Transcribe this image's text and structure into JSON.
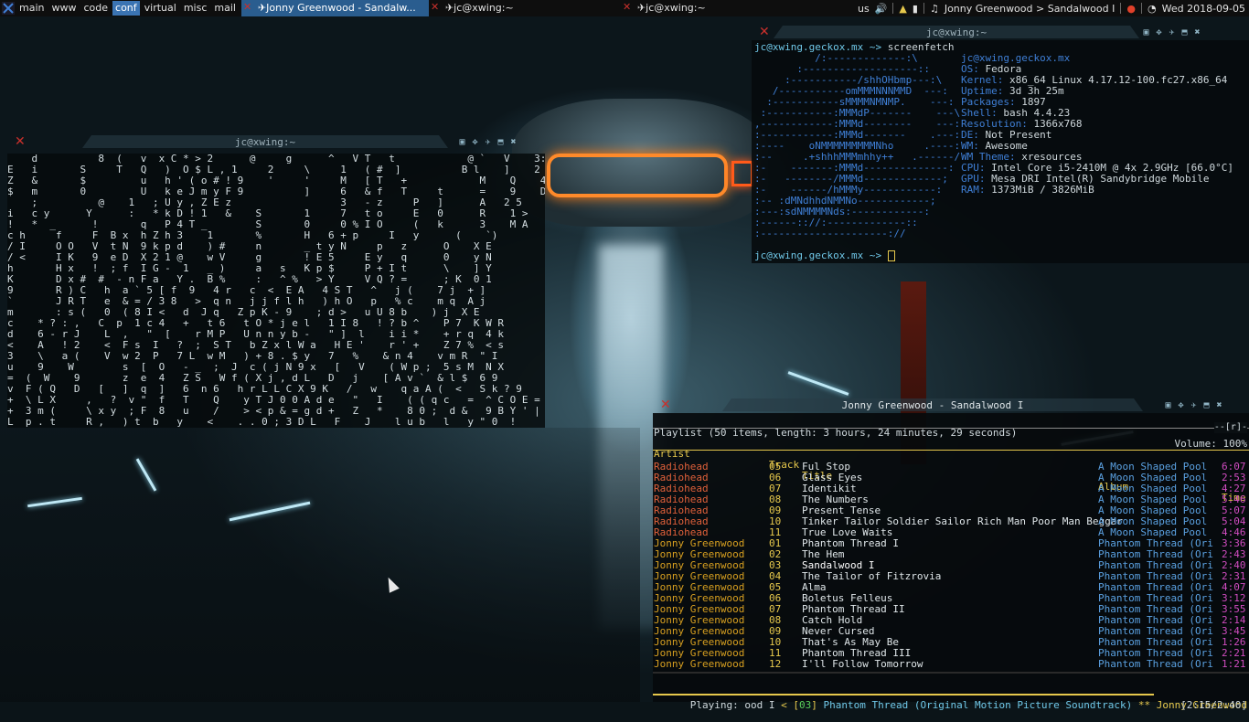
{
  "topbar": {
    "tags": [
      "main",
      "www",
      "code",
      "conf",
      "virtual",
      "misc",
      "mail"
    ],
    "active_tag": "conf",
    "tasks": [
      {
        "title": "Jonny Greenwood - Sandalw...",
        "active": true
      },
      {
        "title": "jc@xwing:~",
        "active": false
      },
      {
        "title": "jc@xwing:~",
        "active": false
      }
    ],
    "layout": "us",
    "now_playing": "Jonny Greenwood > Sandalwood I",
    "date": "Wed 2018-09-05"
  },
  "matrix_window": {
    "title": "jc@xwing:~",
    "lines": [
      "    d          8  (   v  x C * > 2      @     g      ^   V T   t            @ `   V    3:",
      "E   i       S     T   Q   )  O $ L , 1     2     \\     1   ( #  ]          B l    ]    2 p",
      "Z   &       $         u   h ' ( o # ! 9    '     '     M   [ T   +            M    Q    4",
      "$   m       0         U   k e J m y F 9          ]     6   & f   T     t      =    9    D",
      "    ;          @    1   ; U y , Z E z                  3   - z     P   ]      A   2 5    S",
      "i   c y      Y      :   * k D ! 1   &    S       1     7   t o     E   0      R    1 >   6",
      "!   *  _      !       q   P 4 T _        S       0     0 % I O     (   k      3    M A",
      "c h     f     F  B x  h Z h 3    1       %       H   6 + p     I   y      (    `)",
      "/ I     O O   V  t N  9 k p d    ) #     n       _ t y N     p   z      O    X E",
      "/ <     I K   9  e D  X 2 1 @    w V     g       ! E 5     E y   q      0    y N",
      "h       H x   !  ; f  I G -  1   _ )     a   s   K p $     P + I t      \\    ] Y",
      "K       D x #  #  - n F a   Y .  B %     :   ^ %   > Y     V Q ? =      ; K  0 1",
      "9       R ) C   h  a ` 5 [ f  9   4 r   c  <  E A   4 S T   ^   j (    7 j  + ]",
      "`       J R T   e  & = / 3 8   >  q n   j j f l h   ) h O   p   % c    m q  A j",
      "m       : s (   0  ( 8 I <   d  J q   Z p K - 9    ; d >   u U 8 b    ) j  X E",
      "c    * ? : ,   C  p  1 c 4   +   t 6   t O * j e l   1 I 8   ! ? b ^    P 7  K W R",
      "d    6 - r J    L  ,   \"  [    r M P   U n n y b -   \" ]  l    i i *    + r q  4 k",
      "<    A   ! 2    <  F s  I   ?  ;  S T   b Z x l W a   H E '    r ' +    Z 7 %  < s",
      "3    \\   a (    V  w 2  P   7 L  w M   ) + 8 . $ y   7   %    & n 4    v m R  \" I",
      "u    9    W        s  [  O   - _  ;  J  c ( j N 9 x   [   V    ( W p ;  5 s M  N X",
      "=  (  W    9       z  e  4   Z S   W f ( X j , d L   D   j    [ A v `  & l $  6 9",
      "v  F ( Q   D   [   ]  q  ]   6  n 6   h r L L C X 9 K   /   w    q a A (  <   S k ? 9",
      "+  \\ L X     ,   ?  v \"  f   T    Q    y T J 0 0 A d e   \"   I    ( ( q c   =  ^ C O E =",
      "+  3 m (     \\ x y  ; F  8   u    /    > < p & = g d +   Z   *    8 0 ;  d &   9 B Y ' |",
      "L  p . t     R ,   ) t  b   y    <    . . 0 ; 3 D L   F    J    l u b   l   y \" 0  !"
    ]
  },
  "screenfetch_window": {
    "title": "jc@xwing:~",
    "prompt": "jc@xwing.geckox.mx ~> ",
    "command": "screenfetch",
    "prompt2": "jc@xwing.geckox.mx ~> ",
    "logo": [
      "          /:-------------:\\",
      "       :-------------------::",
      "     :-----------/shhOHbmp---:\\",
      "   /-----------omMMMNNNMMD  ---:",
      "  :-----------sMMMMNMNMP.    ---:",
      " :-----------:MMMdP-------    ---\\",
      ",------------:MMMd--------    ---:",
      ":------------:MMMd-------    .---:",
      ":----    oNMMMMMMMMMNho     .----:",
      ":--     .+shhhMMMmhhy++   .------/",
      ":-    -------:MMMd--------------:",
      ":-   --------/MMMd-------------;",
      ":-    ------/hMMMy------------:",
      ":-- :dMNdhhdNMMNo------------;",
      ":---:sdNMMMMNds:------------:",
      ":------:://:-------------::",
      ":---------------------://"
    ],
    "info": [
      {
        "key": "",
        "value": "jc@xwing.geckox.mx"
      },
      {
        "key": "OS: ",
        "value": "Fedora"
      },
      {
        "key": "Kernel: ",
        "value": "x86_64 Linux 4.17.12-100.fc27.x86_64"
      },
      {
        "key": "Uptime: ",
        "value": "3d 3h 25m"
      },
      {
        "key": "Packages: ",
        "value": "1897"
      },
      {
        "key": "Shell: ",
        "value": "bash 4.4.23"
      },
      {
        "key": "Resolution: ",
        "value": "1366x768"
      },
      {
        "key": "DE: ",
        "value": "Not Present"
      },
      {
        "key": "WM: ",
        "value": "Awesome"
      },
      {
        "key": "WM Theme: ",
        "value": "xresources"
      },
      {
        "key": "CPU: ",
        "value": "Intel Core i5-2410M @ 4x 2.9GHz [66.0°C]"
      },
      {
        "key": "GPU: ",
        "value": "Mesa DRI Intel(R) Sandybridge Mobile"
      },
      {
        "key": "RAM: ",
        "value": "1373MiB / 3826MiB"
      }
    ]
  },
  "player_window": {
    "title": "Jonny Greenwood - Sandalwood I",
    "playlist_info": "Playlist (50 items, length: 3 hours, 24 minutes, 29 seconds)",
    "volume": "Volume: 100%",
    "flags": "--[r]-",
    "columns": {
      "artist": "Artist",
      "track": "Track",
      "title": "Title",
      "album": "Album",
      "time": "Time"
    },
    "rows": [
      {
        "artist": "Radiohead",
        "track": "05",
        "title": "Ful Stop",
        "album": "A Moon Shaped Pool",
        "time": "6:07"
      },
      {
        "artist": "Radiohead",
        "track": "06",
        "title": "Glass Eyes",
        "album": "A Moon Shaped Pool",
        "time": "2:53"
      },
      {
        "artist": "Radiohead",
        "track": "07",
        "title": "Identikit",
        "album": "A Moon Shaped Pool",
        "time": "4:27"
      },
      {
        "artist": "Radiohead",
        "track": "08",
        "title": "The Numbers",
        "album": "A Moon Shaped Pool",
        "time": "5:46"
      },
      {
        "artist": "Radiohead",
        "track": "09",
        "title": "Present Tense",
        "album": "A Moon Shaped Pool",
        "time": "5:07"
      },
      {
        "artist": "Radiohead",
        "track": "10",
        "title": "Tinker Tailor Soldier Sailor Rich Man Poor Man Beggar",
        "album": "A Moon Shaped Pool",
        "time": "5:04"
      },
      {
        "artist": "Radiohead",
        "track": "11",
        "title": "True Love Waits",
        "album": "A Moon Shaped Pool",
        "time": "4:46"
      },
      {
        "artist": "Jonny Greenwood",
        "track": "01",
        "title": "Phantom Thread I",
        "album": "Phantom Thread (Ori",
        "time": "3:36"
      },
      {
        "artist": "Jonny Greenwood",
        "track": "02",
        "title": "The Hem",
        "album": "Phantom Thread (Ori",
        "time": "2:43"
      },
      {
        "artist": "Jonny Greenwood",
        "track": "03",
        "title": "Sandalwood I",
        "album": "Phantom Thread (Ori",
        "time": "2:40"
      },
      {
        "artist": "Jonny Greenwood",
        "track": "04",
        "title": "The Tailor of Fitzrovia",
        "album": "Phantom Thread (Ori",
        "time": "2:31"
      },
      {
        "artist": "Jonny Greenwood",
        "track": "05",
        "title": "Alma",
        "album": "Phantom Thread (Ori",
        "time": "4:07"
      },
      {
        "artist": "Jonny Greenwood",
        "track": "06",
        "title": "Boletus Felleus",
        "album": "Phantom Thread (Ori",
        "time": "3:12"
      },
      {
        "artist": "Jonny Greenwood",
        "track": "07",
        "title": "Phantom Thread II",
        "album": "Phantom Thread (Ori",
        "time": "3:55"
      },
      {
        "artist": "Jonny Greenwood",
        "track": "08",
        "title": "Catch Hold",
        "album": "Phantom Thread (Ori",
        "time": "2:14"
      },
      {
        "artist": "Jonny Greenwood",
        "track": "09",
        "title": "Never Cursed",
        "album": "Phantom Thread (Ori",
        "time": "3:45"
      },
      {
        "artist": "Jonny Greenwood",
        "track": "10",
        "title": "That's As May Be",
        "album": "Phantom Thread (Ori",
        "time": "1:26"
      },
      {
        "artist": "Jonny Greenwood",
        "track": "11",
        "title": "Phantom Thread III",
        "album": "Phantom Thread (Ori",
        "time": "2:21"
      },
      {
        "artist": "Jonny Greenwood",
        "track": "12",
        "title": "I'll Follow Tomorrow",
        "album": "Phantom Thread (Ori",
        "time": "1:21"
      }
    ],
    "status_prefix": "Playing: ",
    "status_title": "ood I ",
    "status_track": "03",
    "status_album": " Phantom Thread (Original Motion Picture Soundtrack) ",
    "status_artist": "Jonny Greenwood",
    "status_elapsed": "[2:15/2:40]",
    "progress_fraction": 0.84
  },
  "colors": {
    "accent": "#3b74b3",
    "artist_radiohead": "#e0603a",
    "artist_jonny": "#d8a020",
    "album": "#5aa0e0",
    "time": "#d04cc0",
    "screenfetch_key": "#3f7fd6"
  }
}
